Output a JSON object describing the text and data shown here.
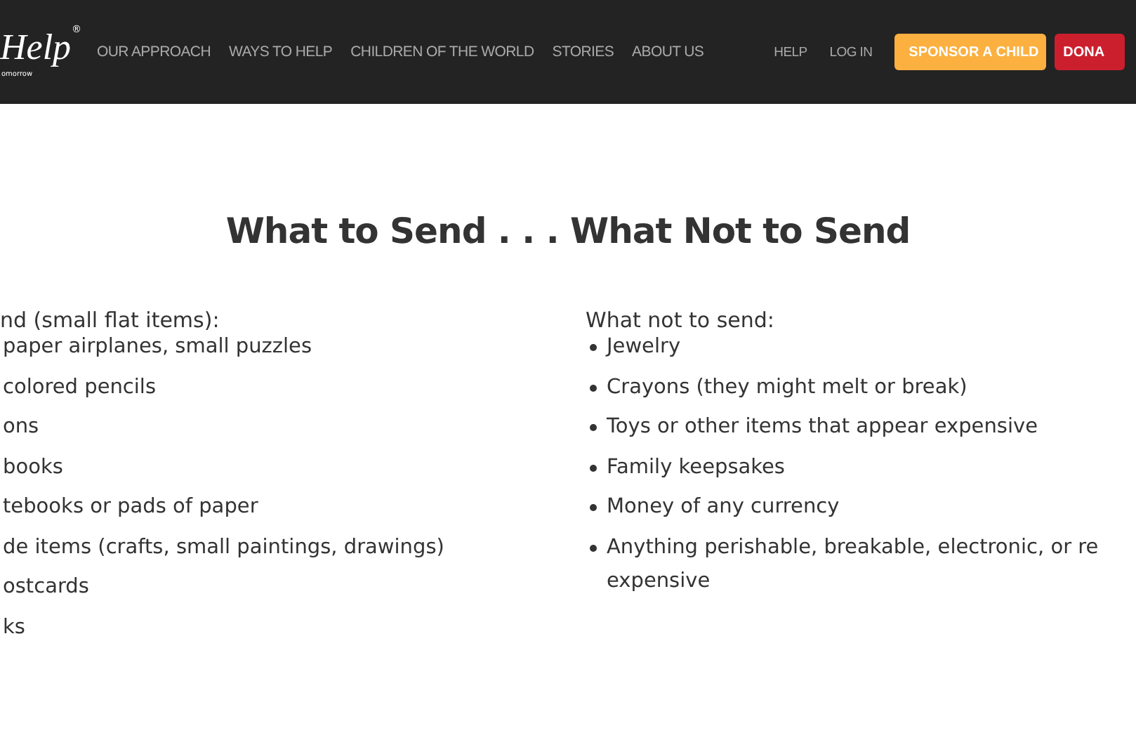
{
  "header": {
    "logo": {
      "word": "Help",
      "mark": "®",
      "tagline": "omorrow"
    },
    "nav": [
      "OUR APPROACH",
      "WAYS TO HELP",
      "CHILDREN OF THE WORLD",
      "STORIES",
      "ABOUT US"
    ],
    "utility": [
      "HELP",
      "LOG IN"
    ],
    "buttons": [
      {
        "kind": "sponsor",
        "label": "SPONSOR A CHILD"
      },
      {
        "kind": "donate",
        "label": "DONA"
      }
    ]
  },
  "title": "What to Send . . . What Not to Send",
  "left": {
    "heading": "nd (small flat items):",
    "items": [
      "paper airplanes, small puzzles",
      "colored pencils",
      "ons",
      "books",
      "tebooks or pads of paper",
      "de items (crafts, small paintings, drawings)",
      "ostcards",
      "ks"
    ]
  },
  "right": {
    "heading": "What not to send:",
    "items": [
      {
        "text": "Jewelry"
      },
      {
        "text": "Crayons (they might melt or break)"
      },
      {
        "text": "Toys or other items that appear expensive"
      },
      {
        "text": "Family keepsakes"
      },
      {
        "text": "Money of any currency"
      },
      {
        "text": "Anything perishable, breakable, electronic, or re",
        "continuation": "expensive"
      }
    ]
  }
}
